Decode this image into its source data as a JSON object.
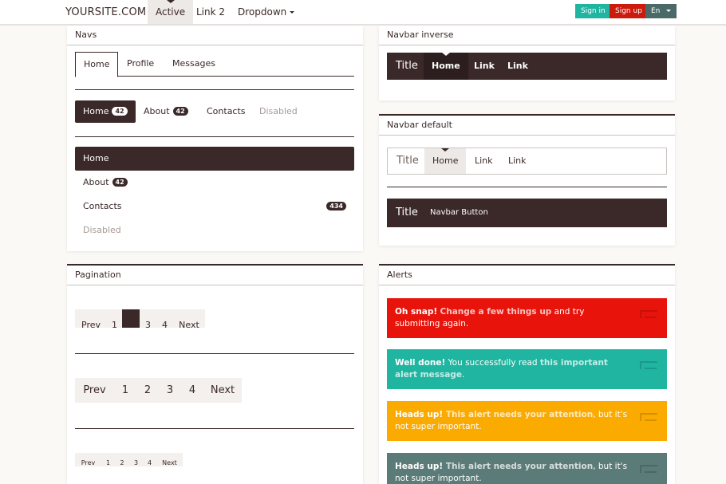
{
  "topbar": {
    "brand": "YOURSITE.COM",
    "nav": [
      "Active",
      "Link 2",
      "Dropdown"
    ],
    "signin": "Sign in",
    "signup": "Sign up",
    "lang": "En"
  },
  "navs": {
    "title": "Navs",
    "tabs": [
      "Home",
      "Profile",
      "Messages"
    ],
    "pills": [
      {
        "label": "Home",
        "badge": "42"
      },
      {
        "label": "About",
        "badge": "42"
      },
      {
        "label": "Contacts",
        "badge": ""
      },
      {
        "label": "Disabled",
        "badge": ""
      }
    ],
    "stacked": [
      {
        "label": "Home",
        "badge": ""
      },
      {
        "label": "About",
        "badge": "42"
      },
      {
        "label": "Contacts",
        "badge": "434"
      },
      {
        "label": "Disabled",
        "badge": ""
      }
    ]
  },
  "navbar_inverse": {
    "title": "Navbar inverse",
    "brand": "Title",
    "links": [
      "Home",
      "Link",
      "Link"
    ]
  },
  "navbar_default": {
    "title": "Navbar default",
    "brand": "Title",
    "links": [
      "Home",
      "Link",
      "Link"
    ],
    "brand2": "Title",
    "button": "Navbar Button"
  },
  "pagination": {
    "title": "Pagination",
    "prev": "Prev",
    "next": "Next",
    "pages_md": [
      "1",
      "",
      "3",
      "4"
    ],
    "pages": [
      "1",
      "2",
      "3",
      "4"
    ]
  },
  "alerts": {
    "title": "Alerts",
    "items": [
      {
        "strong": "Oh snap!",
        "emph": "Change a few things up",
        "rest": " and try submitting again."
      },
      {
        "strong": "Well done!",
        "rest1": " You successfully read ",
        "emph": "this important alert message",
        "rest": "."
      },
      {
        "strong": "Heads up!",
        "emph": " This alert needs your attention",
        "rest": ", but it's not super important."
      },
      {
        "strong": "Heads up!",
        "emph": " This alert needs your attention",
        "rest": ", but it's not super important."
      }
    ]
  },
  "colors": {
    "primary": "#3b2828",
    "success": "#1fb5a0",
    "danger": "#e8140c",
    "signup": "#cc1a0c",
    "warning": "#fbaa00",
    "info": "#5a7b77",
    "lang": "#4a6a68"
  }
}
